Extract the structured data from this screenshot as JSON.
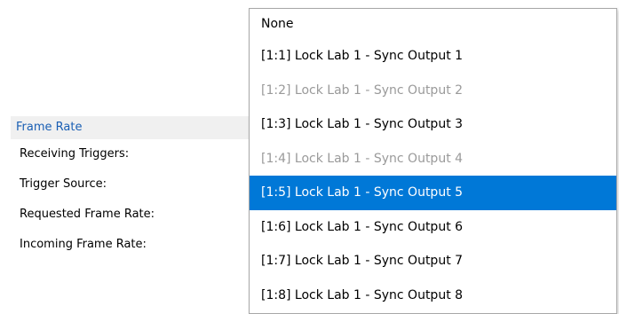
{
  "properties": {
    "section_title": "Frame Rate",
    "rows": [
      {
        "label": "Receiving Triggers:"
      },
      {
        "label": "Trigger Source:"
      },
      {
        "label": "Requested Frame Rate:"
      },
      {
        "label": "Incoming Frame Rate:"
      }
    ]
  },
  "dropdown": {
    "options": [
      {
        "label": "None",
        "state": "enabled"
      },
      {
        "label": "[1:1] Lock Lab 1 - Sync Output 1",
        "state": "enabled"
      },
      {
        "label": "[1:2] Lock Lab 1 - Sync Output 2",
        "state": "disabled"
      },
      {
        "label": "[1:3] Lock Lab 1 - Sync Output 3",
        "state": "enabled"
      },
      {
        "label": "[1:4] Lock Lab 1 - Sync Output 4",
        "state": "disabled"
      },
      {
        "label": "[1:5] Lock Lab 1 - Sync Output 5",
        "state": "selected"
      },
      {
        "label": "[1:6] Lock Lab 1 - Sync Output 6",
        "state": "enabled"
      },
      {
        "label": "[1:7] Lock Lab 1 - Sync Output 7",
        "state": "enabled"
      },
      {
        "label": "[1:8] Lock Lab 1 - Sync Output 8",
        "state": "enabled"
      }
    ]
  },
  "colors": {
    "accent": "#0078d7",
    "section_title": "#1a5fb4",
    "disabled_text": "#9a9a9a"
  }
}
